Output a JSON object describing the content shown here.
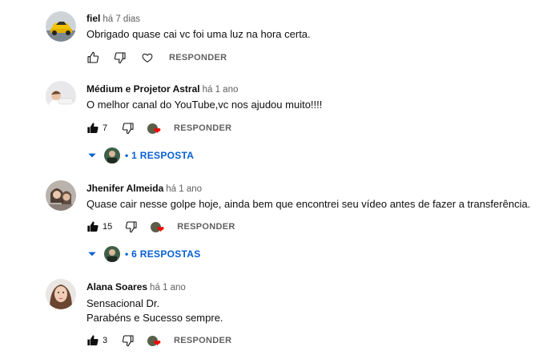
{
  "comments": [
    {
      "author": "fiel",
      "time": "há 7 dias",
      "lines": [
        "Obrigado quase cai vc foi uma luz na hora certa."
      ],
      "likes": "",
      "reply_label": "RESPONDER",
      "hearted": false
    },
    {
      "author": "Médium e Projetor Astral",
      "time": "há 1 ano",
      "lines": [
        "O melhor canal do YouTube,vc nos ajudou muito!!!!"
      ],
      "likes": "7",
      "reply_label": "RESPONDER",
      "hearted": true,
      "replies_label": "• 1 RESPOSTA"
    },
    {
      "author": "Jhenifer Almeida",
      "time": "há 1 ano",
      "lines": [
        "Quase cair nesse golpe hoje, ainda bem que encontrei seu vídeo antes de fazer a transferência."
      ],
      "likes": "15",
      "reply_label": "RESPONDER",
      "hearted": true,
      "replies_label": "• 6 RESPOSTAS"
    },
    {
      "author": "Alana Soares",
      "time": "há 1 ano",
      "lines": [
        "Sensacional Dr.",
        "Parabéns e Sucesso sempre."
      ],
      "likes": "3",
      "reply_label": "RESPONDER",
      "hearted": true
    }
  ],
  "colors": {
    "link_blue": "#065fd4",
    "heart_red": "#ff0000",
    "secondary_text": "#606060"
  }
}
